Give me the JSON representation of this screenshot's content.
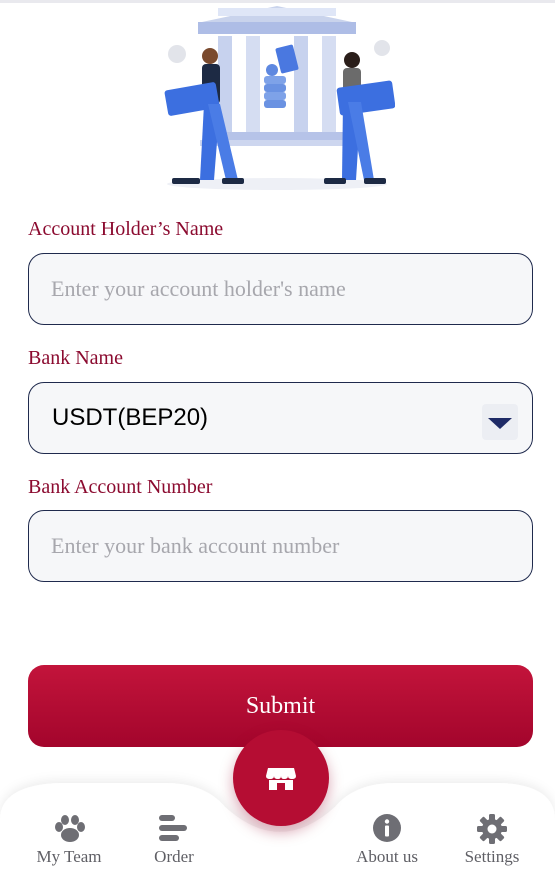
{
  "form": {
    "holder_label": "Account Holder’s Name",
    "holder_placeholder": "Enter your account holder's name",
    "bank_label": "Bank Name",
    "bank_selected": "USDT(BEP20)",
    "account_label": "Bank Account Number",
    "account_placeholder": "Enter your bank account number",
    "submit_label": "Submit"
  },
  "bottom_nav": {
    "items": [
      {
        "label": "My Team",
        "icon": "paw-icon"
      },
      {
        "label": "Order",
        "icon": "bars-icon"
      },
      {
        "label": "About us",
        "icon": "info-icon"
      },
      {
        "label": "Settings",
        "icon": "gear-icon"
      }
    ],
    "center_icon": "store-icon"
  },
  "colors": {
    "accent": "#b50d33",
    "label": "#8b0a2f",
    "field_border": "#1f2a4d"
  }
}
